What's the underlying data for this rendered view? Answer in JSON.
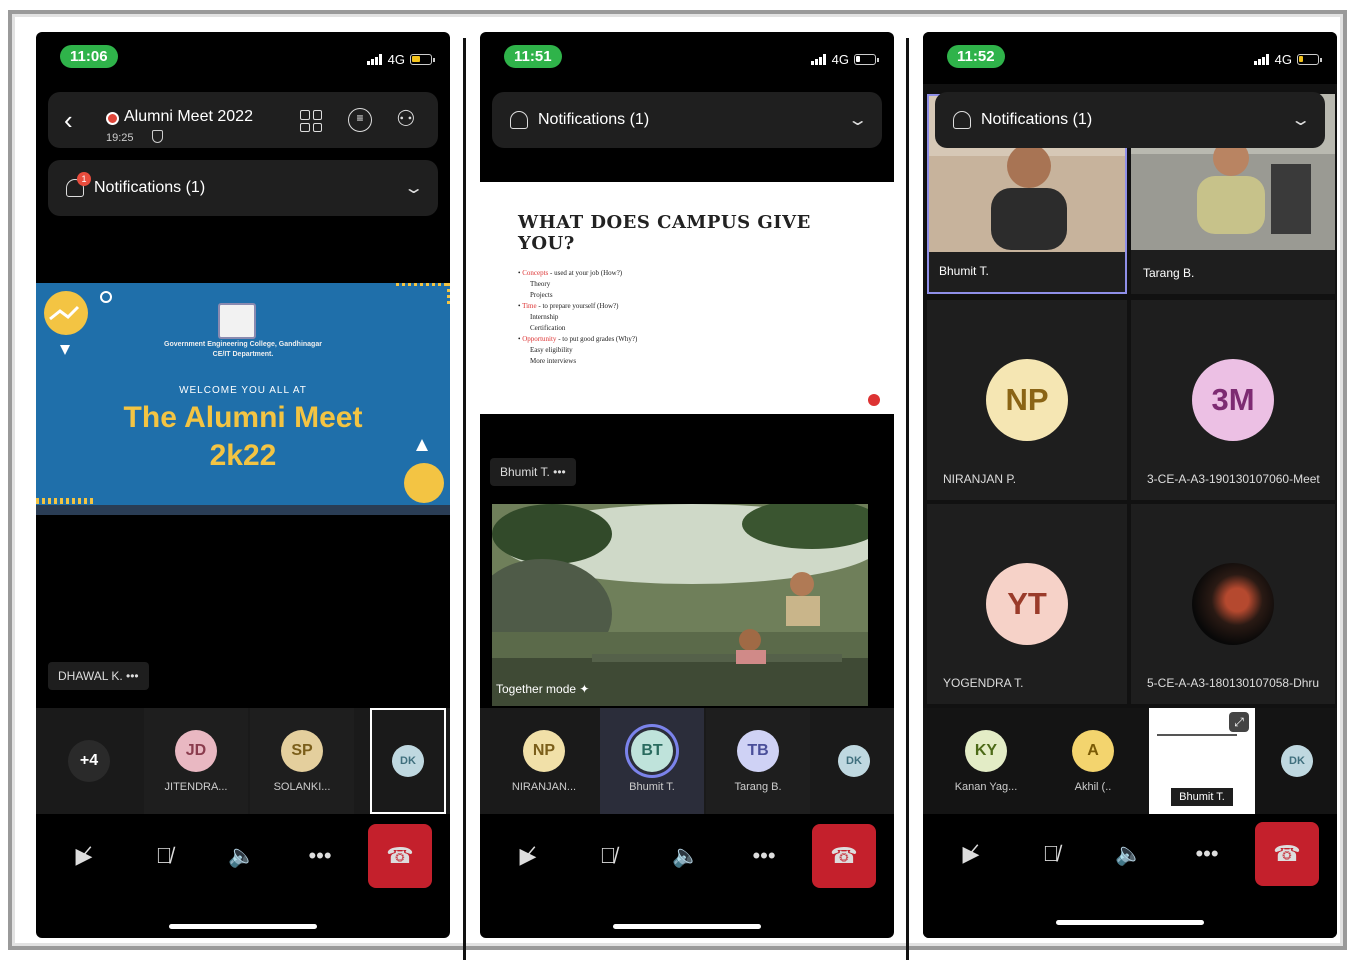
{
  "panel1": {
    "time": "11:06",
    "network": "4G",
    "header": {
      "title": "Alumni Meet 2022",
      "timer": "19:25"
    },
    "notification": {
      "label": "Notifications (1)",
      "badge": "1"
    },
    "slide": {
      "college": "Government Engineering College, Gandhinagar",
      "dept": "CE/IT Department.",
      "welcome": "WELCOME YOU ALL AT",
      "title_line1": "The Alumni Meet",
      "title_line2": "2k22"
    },
    "speaker": "DHAWAL K.",
    "participants": [
      {
        "initials": "+4",
        "name": ""
      },
      {
        "initials": "JD",
        "name": "JITENDRA..."
      },
      {
        "initials": "SP",
        "name": "SOLANKI..."
      },
      {
        "initials": "DK",
        "name": ""
      }
    ]
  },
  "panel2": {
    "time": "11:51",
    "network": "4G",
    "notification": {
      "label": "Notifications (1)"
    },
    "slide": {
      "heading": "WHAT DOES CAMPUS GIVE YOU?",
      "points": [
        {
          "main": "Concepts",
          "rest": " - used at your job (How?)",
          "subs": [
            "Theory",
            "Projects"
          ]
        },
        {
          "main": "Time",
          "rest": " - to prepare yourself (How?)",
          "subs": [
            "Internship",
            "Certification"
          ]
        },
        {
          "main": "Opportunity",
          "rest": " - to put good grades (Why?)",
          "subs": [
            "Easy eligibility",
            "More interviews"
          ]
        }
      ]
    },
    "presenter": "Bhumit T.",
    "together_mode": "Together mode",
    "participants": [
      {
        "initials": "NP",
        "name": "NIRANJAN..."
      },
      {
        "initials": "BT",
        "name": "Bhumit T."
      },
      {
        "initials": "TB",
        "name": "Tarang B."
      },
      {
        "initials": "DK",
        "name": ""
      }
    ]
  },
  "panel3": {
    "time": "11:52",
    "network": "4G",
    "notification": {
      "label": "Notifications (1)"
    },
    "video_tiles": [
      {
        "name": "Bhumit T."
      },
      {
        "name": "Tarang B."
      }
    ],
    "grid": [
      {
        "initials": "NP",
        "name": "NIRANJAN P."
      },
      {
        "initials": "3M",
        "name": "3-CE-A-A3-190130107060-Meet"
      },
      {
        "initials": "YT",
        "name": "YOGENDRA T."
      },
      {
        "initials": "",
        "name": "5-CE-A-A3-180130107058-Dhru"
      }
    ],
    "participants": [
      {
        "initials": "KY",
        "name": "Kanan Yag..."
      },
      {
        "initials": "A",
        "name": "Akhil (.."
      },
      {
        "initials": "",
        "name": "Bhumit T."
      },
      {
        "initials": "DK",
        "name": ""
      }
    ]
  },
  "colors": {
    "end_call": "#c4202c",
    "status_green": "#2fb34a",
    "slide_blue": "#1f6faa",
    "slide_yellow": "#f3c443"
  }
}
